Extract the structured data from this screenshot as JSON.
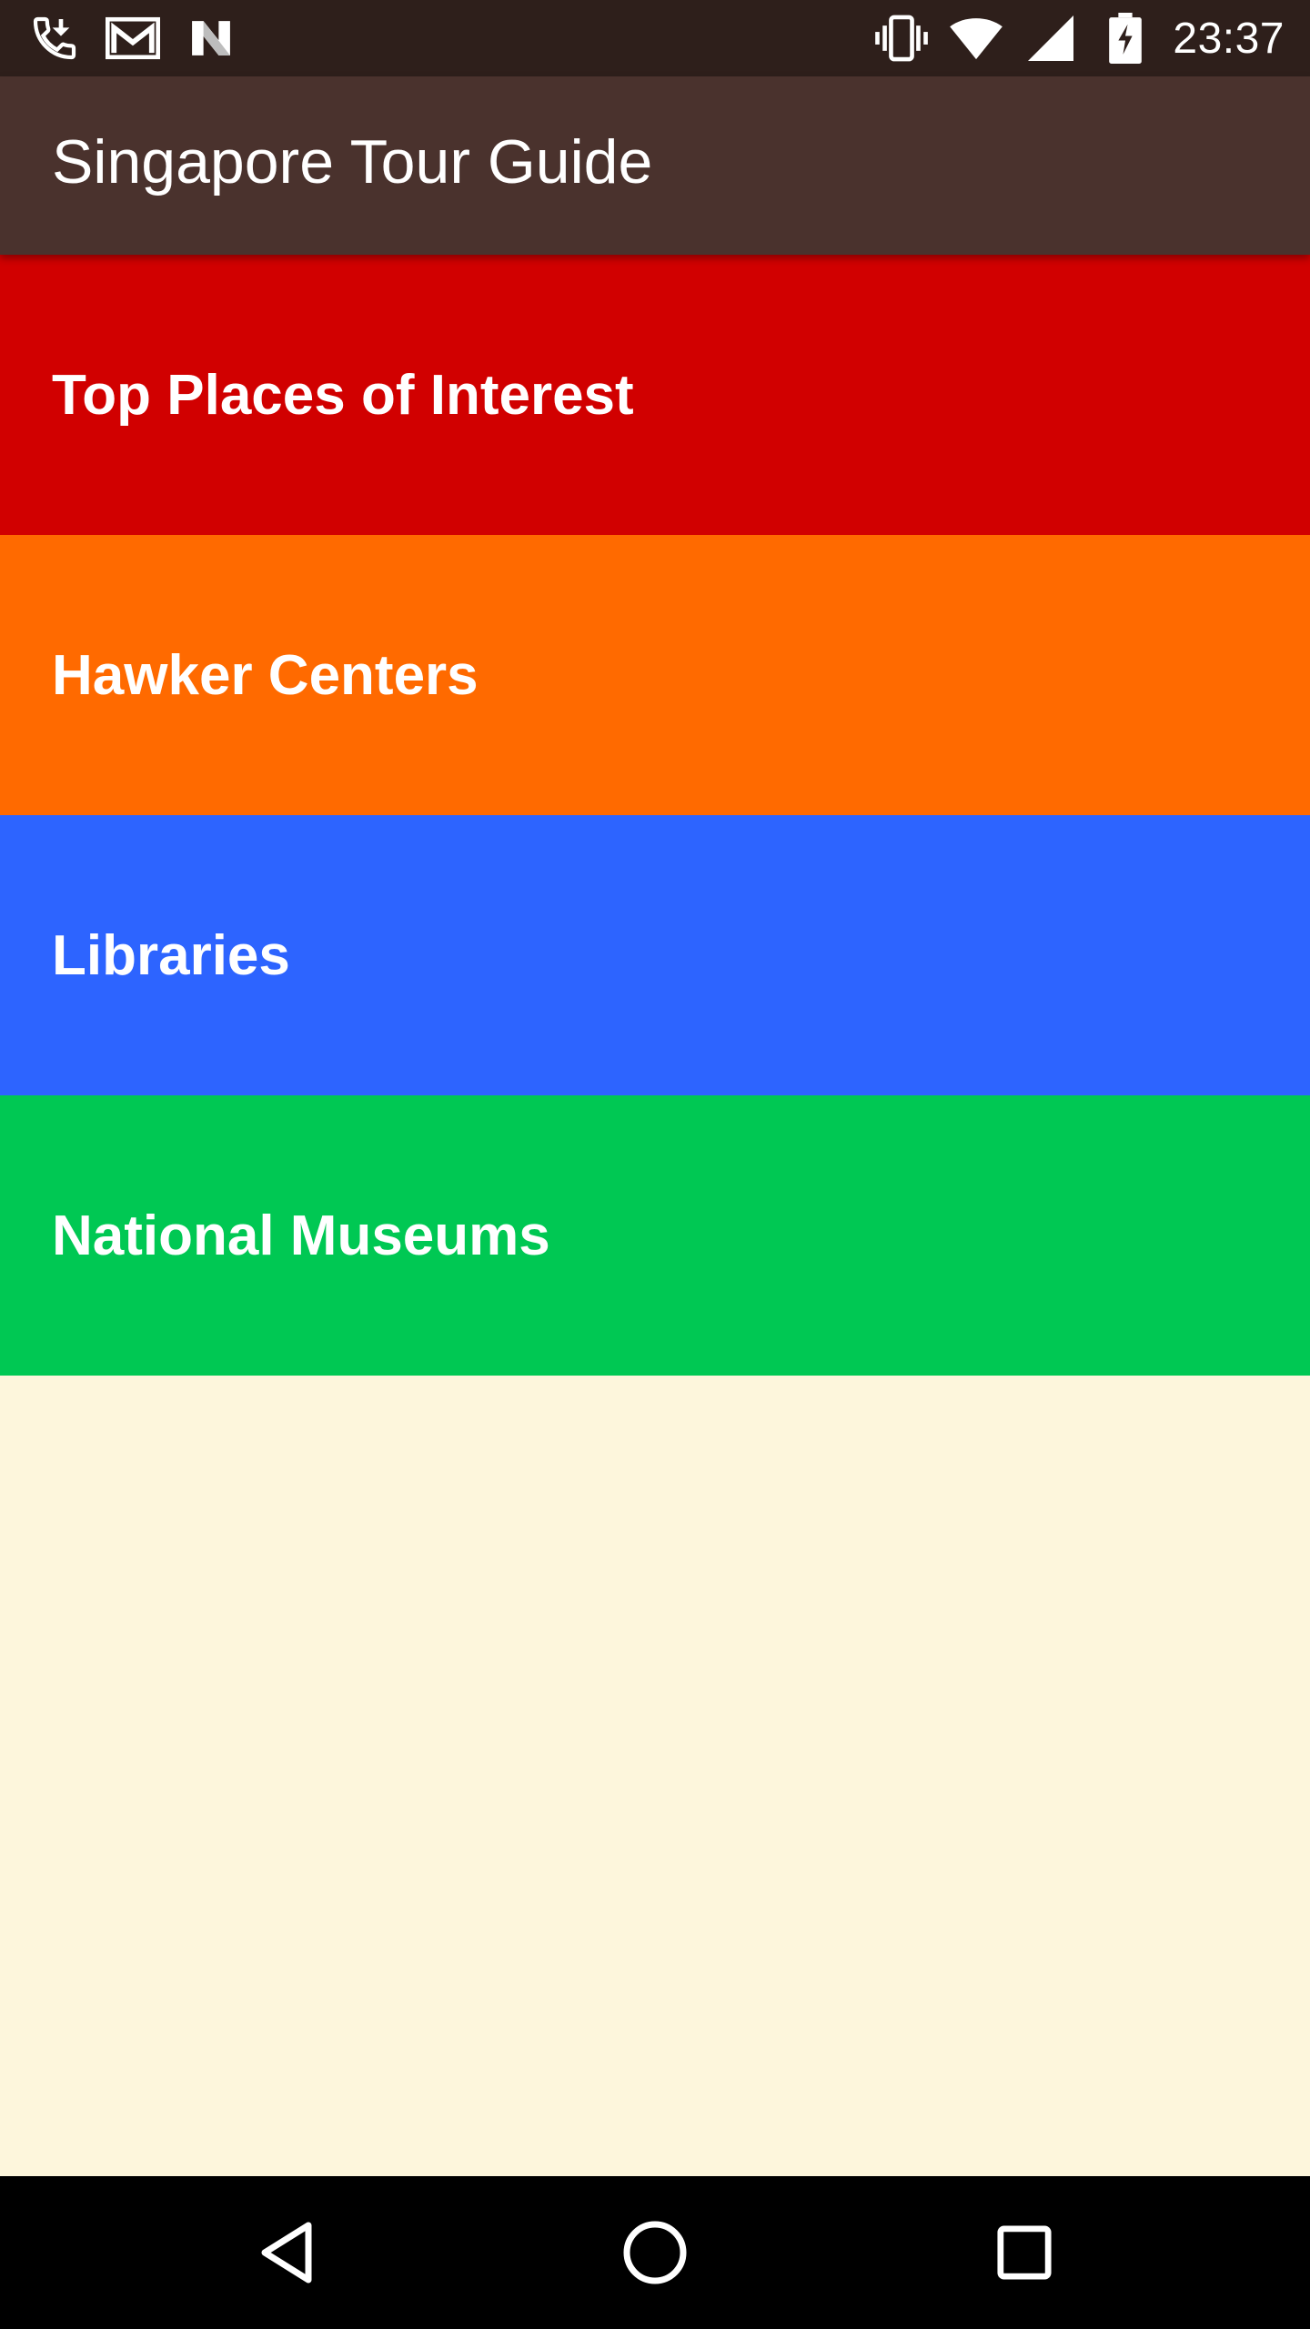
{
  "status_bar": {
    "left_icons": [
      "phone-call-icon",
      "gmail-icon",
      "n-app-icon"
    ],
    "right_icons": [
      "vibrate-icon",
      "wifi-icon",
      "cell-signal-icon",
      "battery-charging-icon"
    ],
    "time": "23:37"
  },
  "app_bar": {
    "title": "Singapore Tour Guide",
    "color": "#4a322d"
  },
  "categories": [
    {
      "label": "Top Places of Interest",
      "color": "#d10000"
    },
    {
      "label": "Hawker Centers",
      "color": "#ff6a00"
    },
    {
      "label": "Libraries",
      "color": "#2d64ff"
    },
    {
      "label": "National Museums",
      "color": "#00c853"
    }
  ],
  "background_color": "#fdf6dc",
  "nav_bar": {
    "buttons": [
      "back-icon",
      "home-icon",
      "recents-icon"
    ]
  }
}
